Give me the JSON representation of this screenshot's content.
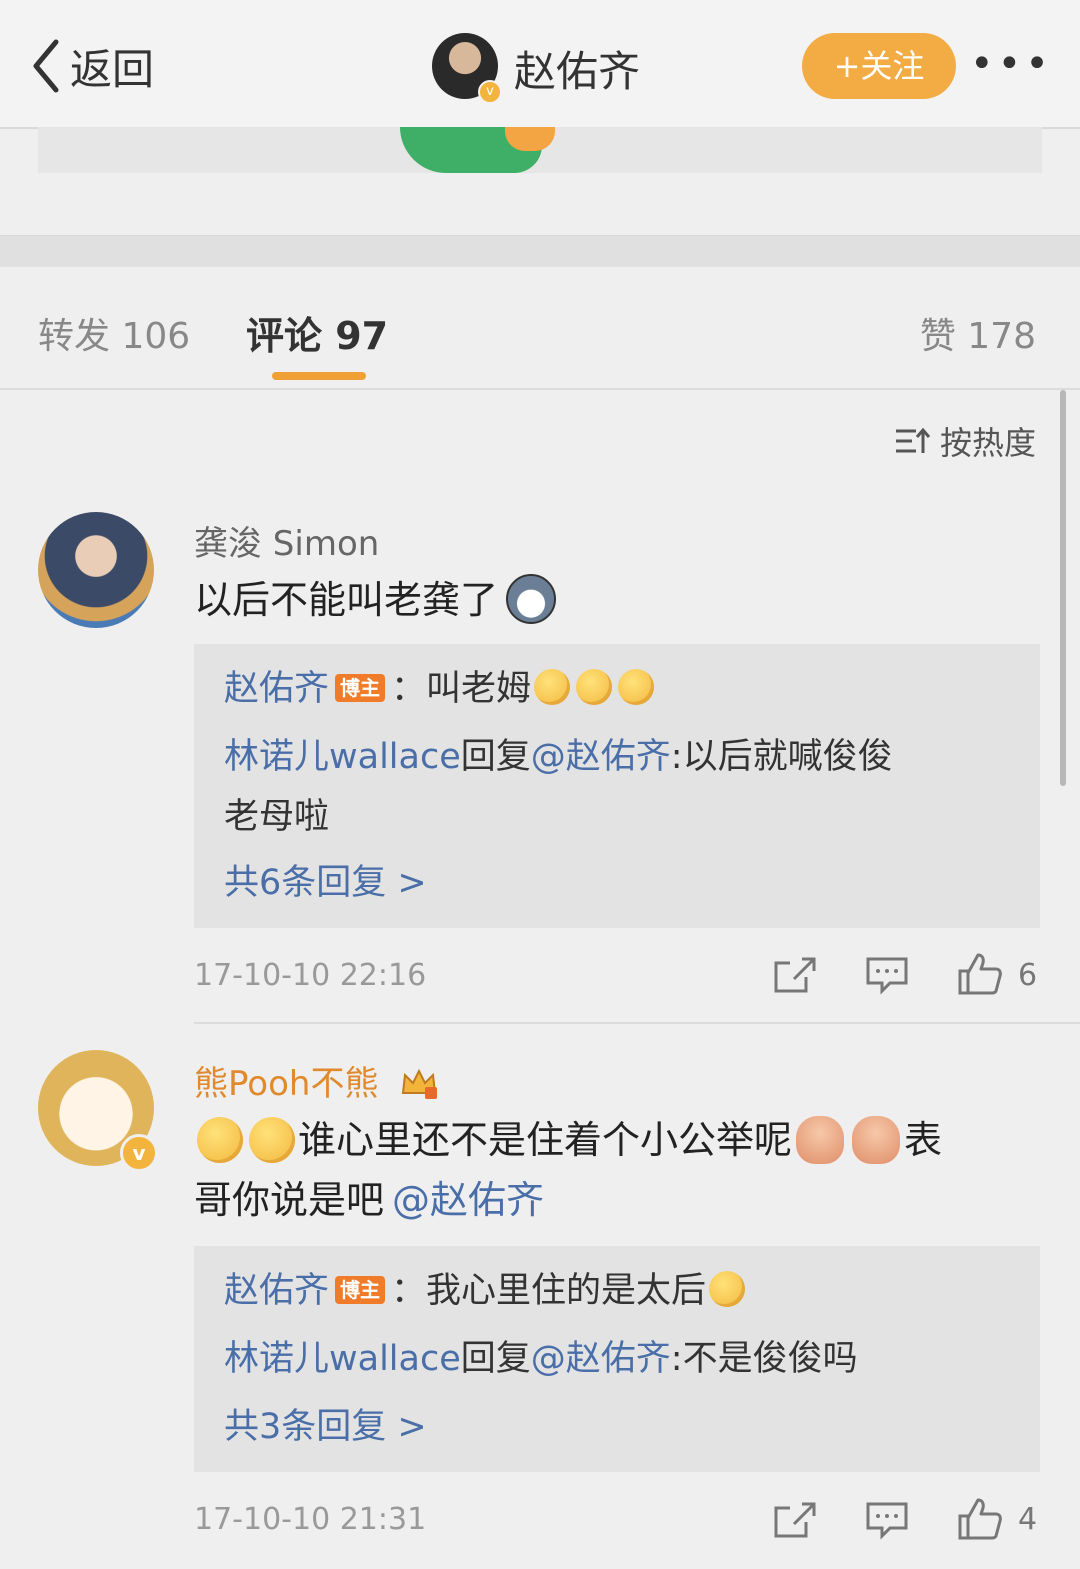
{
  "header": {
    "back_label": "返回",
    "user_name": "赵佑齐",
    "follow_label": "+关注",
    "more_label": "•••"
  },
  "tabs": {
    "repost": "转发 106",
    "comment": "评论 97",
    "like": "赞 178"
  },
  "sort_label": "按热度",
  "comments": [
    {
      "user": "龚浚 Simon",
      "text": "以后不能叫老龚了",
      "replies": [
        {
          "author": "赵佑齐",
          "badge": "博主",
          "text": "：叫老姆"
        },
        {
          "author": "林诺儿wallace",
          "text_prefix": "回复",
          "mention": "@赵佑齐",
          "text": ":以后就喊俊俊",
          "text_line2": "老母啦"
        }
      ],
      "more_replies": "共6条回复 >",
      "time": "17-10-10 22:16",
      "likes": "6"
    },
    {
      "user": "熊Pooh不熊",
      "text_line1": "谁心里还不是住着个小公举呢",
      "text_line1_tail": "表",
      "text_line2": "哥你说是吧",
      "mention": "@赵佑齐",
      "replies": [
        {
          "author": "赵佑齐",
          "badge": "博主",
          "text": "：我心里住的是太后"
        },
        {
          "author": "林诺儿wallace",
          "text_prefix": "回复",
          "mention": "@赵佑齐",
          "text": ":不是俊俊吗"
        }
      ],
      "more_replies": "共3条回复 >",
      "time": "17-10-10 21:31",
      "likes": "4"
    }
  ],
  "colors": {
    "accent": "#f2ac43",
    "link_blue": "#4a6ea8",
    "vip_name": "#e08a2e"
  }
}
